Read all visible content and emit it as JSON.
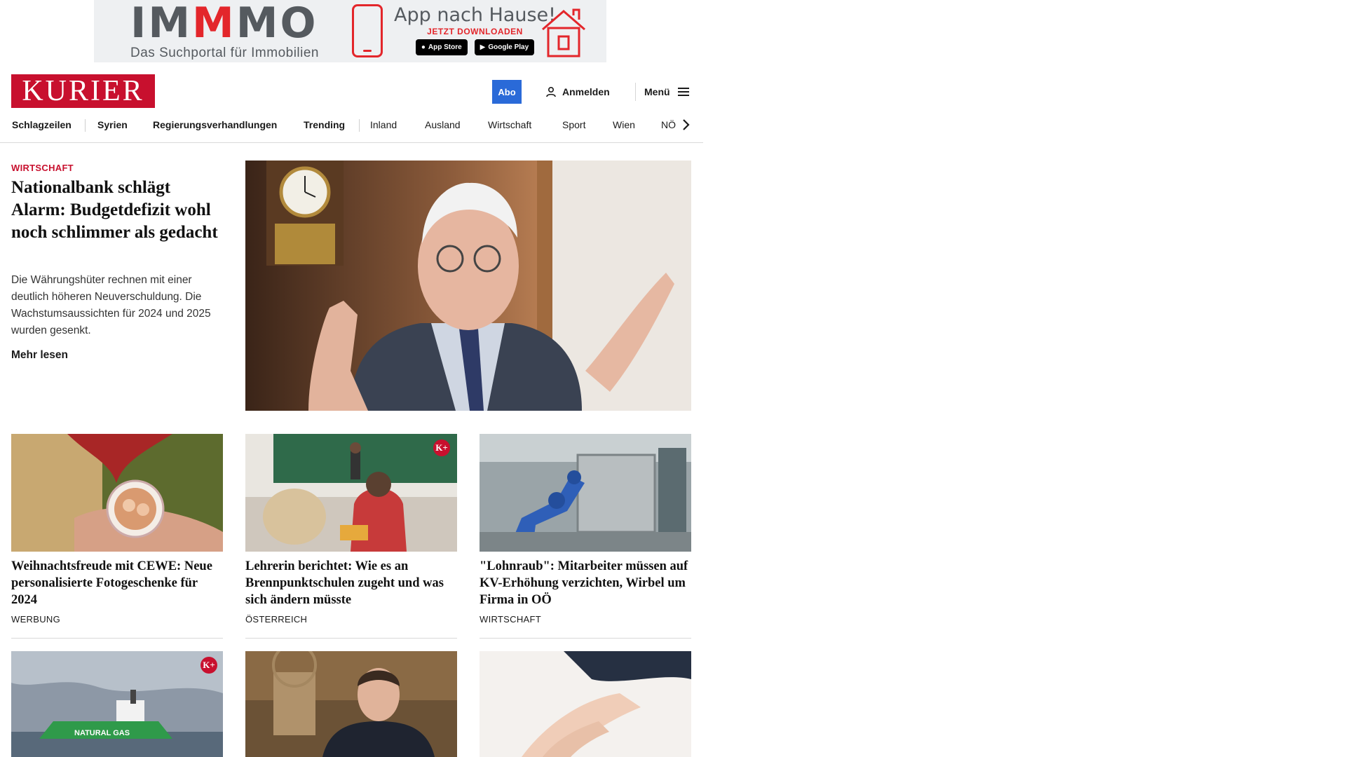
{
  "ad": {
    "logo_prefix": "IM",
    "logo_accent": "M",
    "logo_suffix": "MO",
    "logo_sub": "Das Suchportal für Immobilien",
    "headline": "App nach Hause!",
    "cta": "JETZT DOWNLOADEN",
    "app_store": "App Store",
    "google_play": "Google Play"
  },
  "header": {
    "logo": "KURIER",
    "abo_label": "Abo",
    "login_label": "Anmelden",
    "menu_label": "Menü"
  },
  "nav": {
    "items": [
      "Schlagzeilen",
      "Syrien",
      "Regierungsverhandlungen",
      "Trending",
      "Inland",
      "Ausland",
      "Wirtschaft",
      "Sport",
      "Wien",
      "NÖ"
    ]
  },
  "lead": {
    "category": "WIRTSCHAFT",
    "title": "Nationalbank schlägt Alarm: Budgetdefizit wohl noch schlimmer als gedacht",
    "teaser": "Die Währungshüter rechnen mit einer deutlich höheren Neuverschuldung. Die Wachstumsaussichten für 2024 und 2025 wurden gesenkt.",
    "more": "Mehr lesen"
  },
  "cards": [
    {
      "title": "Weihnachtsfreude mit CEWE: Neue personalisierte Fotogeschenke für 2024",
      "category": "WERBUNG",
      "premium": false
    },
    {
      "title": "Lehrerin berichtet: Wie es an Brennpunktschulen zugeht und was sich ändern müsste",
      "category": "ÖSTERREICH",
      "premium": true
    },
    {
      "title": "\"Lohnraub\": Mitarbeiter müssen auf KV-Erhöhung verzichten, Wir­bel um Firma in OÖ",
      "category": "WIRTSCHAFT",
      "premium": false
    },
    {
      "title": "",
      "category": "",
      "premium": true,
      "image_text": "NATURAL GAS"
    },
    {
      "title": "",
      "category": "",
      "premium": false
    },
    {
      "title": "",
      "category": "",
      "premium": false
    }
  ],
  "badges": {
    "kplus": "K+"
  },
  "colors": {
    "brand": "#c8102e",
    "abo": "#2a6ad8"
  },
  "icons": {
    "login": "user-icon",
    "menu": "hamburger-icon",
    "nav_next": "chevron-right-icon"
  }
}
